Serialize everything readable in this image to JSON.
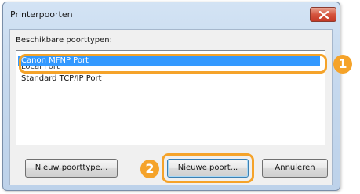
{
  "window": {
    "title": "Printerpoorten"
  },
  "port_types": {
    "label": "Beschikbare poorttypen:",
    "items": [
      "Canon MFNP Port",
      "Local Port",
      "Standard TCP/IP Port"
    ],
    "selected": "Canon MFNP Port"
  },
  "buttons": {
    "new_port_type": "Nieuw poorttype...",
    "new_port": "Nieuwe poort...",
    "cancel": "Annuleren"
  },
  "annotations": {
    "badge_1": "1",
    "badge_2": "2",
    "color": "#f5a32a"
  },
  "colors": {
    "selection": "#3399ff",
    "close_button": "#d5553f"
  }
}
